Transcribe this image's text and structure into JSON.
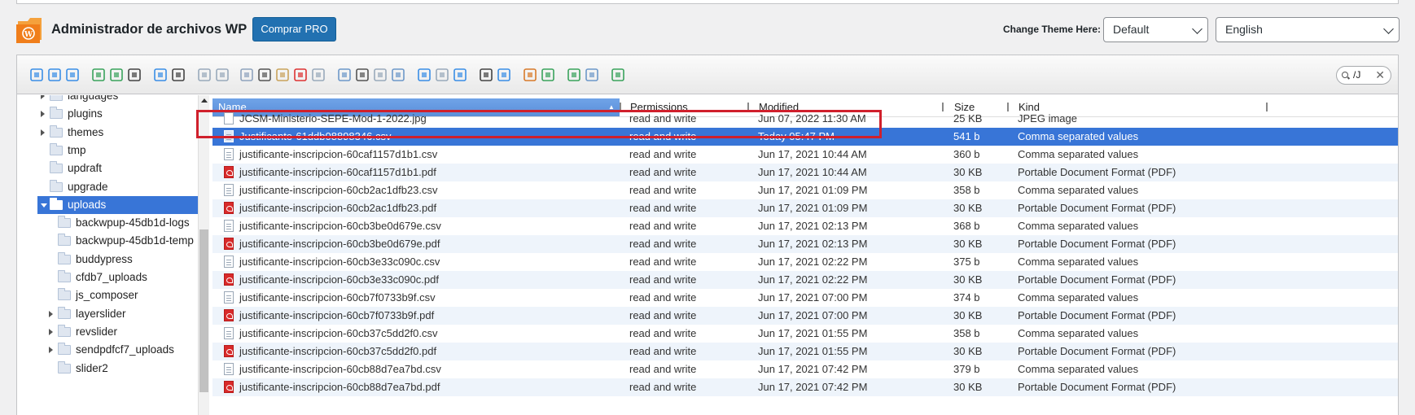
{
  "header": {
    "title": "Administrador de archivos WP",
    "pro_button": "Comprar PRO",
    "theme_label": "Change Theme Here:",
    "theme_value": "Default",
    "language_value": "English"
  },
  "search": {
    "value": "/J"
  },
  "tree": {
    "items": [
      {
        "label": "languages",
        "level": 1,
        "expandable": true
      },
      {
        "label": "plugins",
        "level": 1,
        "expandable": true
      },
      {
        "label": "themes",
        "level": 1,
        "expandable": true
      },
      {
        "label": "tmp",
        "level": 1,
        "expandable": false
      },
      {
        "label": "updraft",
        "level": 1,
        "expandable": false
      },
      {
        "label": "upgrade",
        "level": 1,
        "expandable": false
      },
      {
        "label": "uploads",
        "level": 1,
        "expandable": true,
        "selected": true
      },
      {
        "label": "backwpup-45db1d-logs",
        "level": 2,
        "expandable": false
      },
      {
        "label": "backwpup-45db1d-temp",
        "level": 2,
        "expandable": false
      },
      {
        "label": "buddypress",
        "level": 2,
        "expandable": false
      },
      {
        "label": "cfdb7_uploads",
        "level": 2,
        "expandable": false
      },
      {
        "label": "js_composer",
        "level": 2,
        "expandable": false
      },
      {
        "label": "layerslider",
        "level": 2,
        "expandable": true
      },
      {
        "label": "revslider",
        "level": 2,
        "expandable": true
      },
      {
        "label": "sendpdfcf7_uploads",
        "level": 2,
        "expandable": true
      },
      {
        "label": "slider2",
        "level": 2,
        "expandable": false
      }
    ]
  },
  "columns": {
    "name": "Name",
    "permissions": "Permissions",
    "modified": "Modified",
    "size": "Size",
    "kind": "Kind"
  },
  "files": [
    {
      "name": "JCSM-Ministerio-SEPE-Mod-1-2022.jpg",
      "perm": "read and write",
      "mod": "Jun 07, 2022 11:30 AM",
      "size": "25 KB",
      "kind": "JPEG image",
      "type": "img"
    },
    {
      "name": "Justificante-61ddb08898346.csv",
      "perm": "read and write",
      "mod": "Today 05:47 PM",
      "size": "541 b",
      "kind": "Comma separated values",
      "type": "csv",
      "selected": true
    },
    {
      "name": "justificante-inscripcion-60caf1157d1b1.csv",
      "perm": "read and write",
      "mod": "Jun 17, 2021 10:44 AM",
      "size": "360 b",
      "kind": "Comma separated values",
      "type": "csv"
    },
    {
      "name": "justificante-inscripcion-60caf1157d1b1.pdf",
      "perm": "read and write",
      "mod": "Jun 17, 2021 10:44 AM",
      "size": "30 KB",
      "kind": "Portable Document Format (PDF)",
      "type": "pdf"
    },
    {
      "name": "justificante-inscripcion-60cb2ac1dfb23.csv",
      "perm": "read and write",
      "mod": "Jun 17, 2021 01:09 PM",
      "size": "358 b",
      "kind": "Comma separated values",
      "type": "csv"
    },
    {
      "name": "justificante-inscripcion-60cb2ac1dfb23.pdf",
      "perm": "read and write",
      "mod": "Jun 17, 2021 01:09 PM",
      "size": "30 KB",
      "kind": "Portable Document Format (PDF)",
      "type": "pdf"
    },
    {
      "name": "justificante-inscripcion-60cb3be0d679e.csv",
      "perm": "read and write",
      "mod": "Jun 17, 2021 02:13 PM",
      "size": "368 b",
      "kind": "Comma separated values",
      "type": "csv"
    },
    {
      "name": "justificante-inscripcion-60cb3be0d679e.pdf",
      "perm": "read and write",
      "mod": "Jun 17, 2021 02:13 PM",
      "size": "30 KB",
      "kind": "Portable Document Format (PDF)",
      "type": "pdf"
    },
    {
      "name": "justificante-inscripcion-60cb3e33c090c.csv",
      "perm": "read and write",
      "mod": "Jun 17, 2021 02:22 PM",
      "size": "375 b",
      "kind": "Comma separated values",
      "type": "csv"
    },
    {
      "name": "justificante-inscripcion-60cb3e33c090c.pdf",
      "perm": "read and write",
      "mod": "Jun 17, 2021 02:22 PM",
      "size": "30 KB",
      "kind": "Portable Document Format (PDF)",
      "type": "pdf"
    },
    {
      "name": "justificante-inscripcion-60cb7f0733b9f.csv",
      "perm": "read and write",
      "mod": "Jun 17, 2021 07:00 PM",
      "size": "374 b",
      "kind": "Comma separated values",
      "type": "csv"
    },
    {
      "name": "justificante-inscripcion-60cb7f0733b9f.pdf",
      "perm": "read and write",
      "mod": "Jun 17, 2021 07:00 PM",
      "size": "30 KB",
      "kind": "Portable Document Format (PDF)",
      "type": "pdf"
    },
    {
      "name": "justificante-inscripcion-60cb37c5dd2f0.csv",
      "perm": "read and write",
      "mod": "Jun 17, 2021 01:55 PM",
      "size": "358 b",
      "kind": "Comma separated values",
      "type": "csv"
    },
    {
      "name": "justificante-inscripcion-60cb37c5dd2f0.pdf",
      "perm": "read and write",
      "mod": "Jun 17, 2021 01:55 PM",
      "size": "30 KB",
      "kind": "Portable Document Format (PDF)",
      "type": "pdf"
    },
    {
      "name": "justificante-inscripcion-60cb88d7ea7bd.csv",
      "perm": "read and write",
      "mod": "Jun 17, 2021 07:42 PM",
      "size": "379 b",
      "kind": "Comma separated values",
      "type": "csv"
    },
    {
      "name": "justificante-inscripcion-60cb88d7ea7bd.pdf",
      "perm": "read and write",
      "mod": "Jun 17, 2021 07:42 PM",
      "size": "30 KB",
      "kind": "Portable Document Format (PDF)",
      "type": "pdf"
    }
  ],
  "colors": {
    "accent": "#2271b1",
    "selection": "#3875d7",
    "highlight_box": "#d0202c",
    "row_alt": "#eef4fb"
  },
  "toolbar_icons": [
    "back-icon",
    "forward-icon",
    "up-icon",
    "download-icon",
    "upload-icon",
    "save-icon",
    "open-icon",
    "save-as-icon",
    "undo-icon",
    "redo-icon",
    "copy-icon",
    "cut-icon",
    "paste-icon",
    "delete-icon",
    "empty-icon",
    "duplicate-icon",
    "select-all-icon",
    "edit-icon",
    "resize-icon",
    "icons-view-icon",
    "list-view-icon",
    "columns-view-icon",
    "preview-icon",
    "info-icon",
    "extract-icon",
    "archive-icon",
    "grid-icon",
    "sort-icon",
    "fullscreen-icon"
  ]
}
